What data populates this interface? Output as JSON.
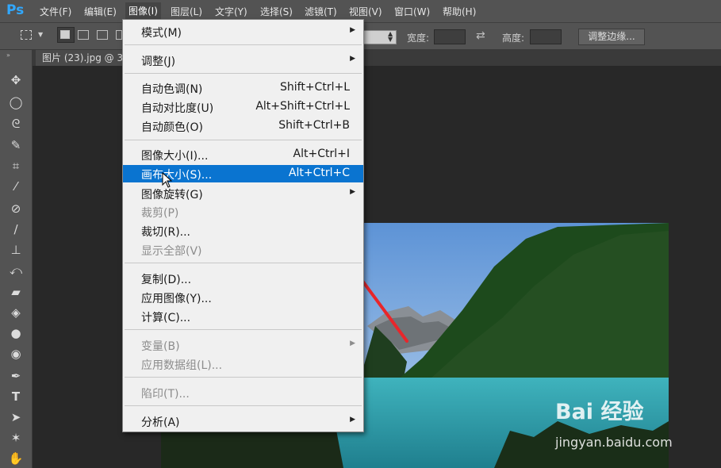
{
  "app": {
    "logo": "Ps"
  },
  "menubar": {
    "items": [
      {
        "label": "文件(F)"
      },
      {
        "label": "编辑(E)"
      },
      {
        "label": "图像(I)"
      },
      {
        "label": "图层(L)"
      },
      {
        "label": "文字(Y)"
      },
      {
        "label": "选择(S)"
      },
      {
        "label": "滤镜(T)"
      },
      {
        "label": "视图(V)"
      },
      {
        "label": "窗口(W)"
      },
      {
        "label": "帮助(H)"
      }
    ]
  },
  "options": {
    "width_label": "宽度:",
    "height_label": "高度:",
    "refine_edge": "调整边缘..."
  },
  "document": {
    "tab_title": "图片 (23).jpg @ 33"
  },
  "image_menu": {
    "items": [
      {
        "label": "模式(M)",
        "shortcut": "",
        "submenu": true,
        "disabled": false
      },
      {
        "label": "调整(J)",
        "shortcut": "",
        "submenu": true,
        "disabled": false
      },
      {
        "label": "自动色调(N)",
        "shortcut": "Shift+Ctrl+L",
        "submenu": false,
        "disabled": false
      },
      {
        "label": "自动对比度(U)",
        "shortcut": "Alt+Shift+Ctrl+L",
        "submenu": false,
        "disabled": false
      },
      {
        "label": "自动颜色(O)",
        "shortcut": "Shift+Ctrl+B",
        "submenu": false,
        "disabled": false
      },
      {
        "label": "图像大小(I)...",
        "shortcut": "Alt+Ctrl+I",
        "submenu": false,
        "disabled": false
      },
      {
        "label": "画布大小(S)...",
        "shortcut": "Alt+Ctrl+C",
        "submenu": false,
        "disabled": false,
        "highlighted": true
      },
      {
        "label": "图像旋转(G)",
        "shortcut": "",
        "submenu": true,
        "disabled": false
      },
      {
        "label": "裁剪(P)",
        "shortcut": "",
        "submenu": false,
        "disabled": true
      },
      {
        "label": "裁切(R)...",
        "shortcut": "",
        "submenu": false,
        "disabled": false
      },
      {
        "label": "显示全部(V)",
        "shortcut": "",
        "submenu": false,
        "disabled": true
      },
      {
        "label": "复制(D)...",
        "shortcut": "",
        "submenu": false,
        "disabled": false
      },
      {
        "label": "应用图像(Y)...",
        "shortcut": "",
        "submenu": false,
        "disabled": false
      },
      {
        "label": "计算(C)...",
        "shortcut": "",
        "submenu": false,
        "disabled": false
      },
      {
        "label": "变量(B)",
        "shortcut": "",
        "submenu": true,
        "disabled": true
      },
      {
        "label": "应用数据组(L)...",
        "shortcut": "",
        "submenu": false,
        "disabled": true
      },
      {
        "label": "陷印(T)...",
        "shortcut": "",
        "submenu": false,
        "disabled": true
      },
      {
        "label": "分析(A)",
        "shortcut": "",
        "submenu": true,
        "disabled": false
      }
    ]
  },
  "watermark": {
    "main": "Bai 经验",
    "sub": "jingyan.baidu.com"
  },
  "colors": {
    "accent": "#0a74d0",
    "annotation_arrow": "#e8262b"
  }
}
